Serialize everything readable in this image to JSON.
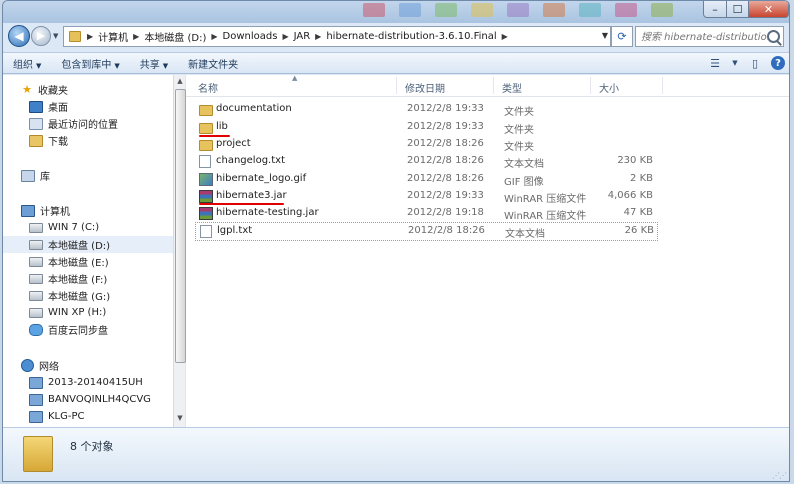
{
  "window": {
    "controls": {
      "minimize": "–",
      "maximize": "☐",
      "close": "✕"
    }
  },
  "address": {
    "segments": [
      "计算机",
      "本地磁盘 (D:)",
      "Downloads",
      "JAR",
      "hibernate-distribution-3.6.10.Final"
    ],
    "back_glyph": "◀",
    "forward_glyph": "▶",
    "refresh_glyph": "⟳"
  },
  "search": {
    "placeholder": "搜索 hibernate-distributio..."
  },
  "toolbar": {
    "organize": "组织",
    "include_in_library": "包含到库中",
    "share": "共享",
    "new_folder": "新建文件夹",
    "icons": [
      "view-options-icon",
      "preview-pane-icon",
      "help-icon"
    ],
    "help_glyph": "?"
  },
  "nav": {
    "favorites": "收藏夹",
    "desktop": "桌面",
    "recent": "最近访问的位置",
    "downloads": "下载",
    "libraries": "库",
    "computer": "计算机",
    "drive_c": "WIN 7 (C:)",
    "drive_d": "本地磁盘 (D:)",
    "drive_e": "本地磁盘 (E:)",
    "drive_f": "本地磁盘 (F:)",
    "drive_g": "本地磁盘 (G:)",
    "drive_h": "WIN XP (H:)",
    "baidu": "百度云同步盘",
    "network": "网络",
    "host1": "2013-20140415UH",
    "host2": "BANVOQINLH4QCVG",
    "host3": "KLG-PC",
    "selected": "drive_d"
  },
  "columns": {
    "name": "名称",
    "date": "修改日期",
    "type": "类型",
    "size": "大小"
  },
  "files": [
    {
      "name": "documentation",
      "date": "2012/2/8 19:33",
      "type": "文件夹",
      "size": "",
      "icon": "folder"
    },
    {
      "name": "lib",
      "date": "2012/2/8 19:33",
      "type": "文件夹",
      "size": "",
      "icon": "folder"
    },
    {
      "name": "project",
      "date": "2012/2/8 18:26",
      "type": "文件夹",
      "size": "",
      "icon": "folder"
    },
    {
      "name": "changelog.txt",
      "date": "2012/2/8 18:26",
      "type": "文本文档",
      "size": "230 KB",
      "icon": "txt"
    },
    {
      "name": "hibernate_logo.gif",
      "date": "2012/2/8 18:26",
      "type": "GIF 图像",
      "size": "2 KB",
      "icon": "gif"
    },
    {
      "name": "hibernate3.jar",
      "date": "2012/2/8 19:33",
      "type": "WinRAR 压缩文件",
      "size": "4,066 KB",
      "icon": "jar"
    },
    {
      "name": "hibernate-testing.jar",
      "date": "2012/2/8 19:18",
      "type": "WinRAR 压缩文件",
      "size": "47 KB",
      "icon": "jar"
    },
    {
      "name": "lgpl.txt",
      "date": "2012/2/8 18:26",
      "type": "文本文档",
      "size": "26 KB",
      "icon": "txt"
    }
  ],
  "annotations": {
    "underline_color": "#e00000",
    "underlined": [
      "lib",
      "hibernate3.jar"
    ]
  },
  "status": {
    "count_text": "8 个对象"
  },
  "colors": {
    "selection": "#e6eefa",
    "window_frame": "#dce8f5",
    "accent": "#2f6cc0"
  }
}
